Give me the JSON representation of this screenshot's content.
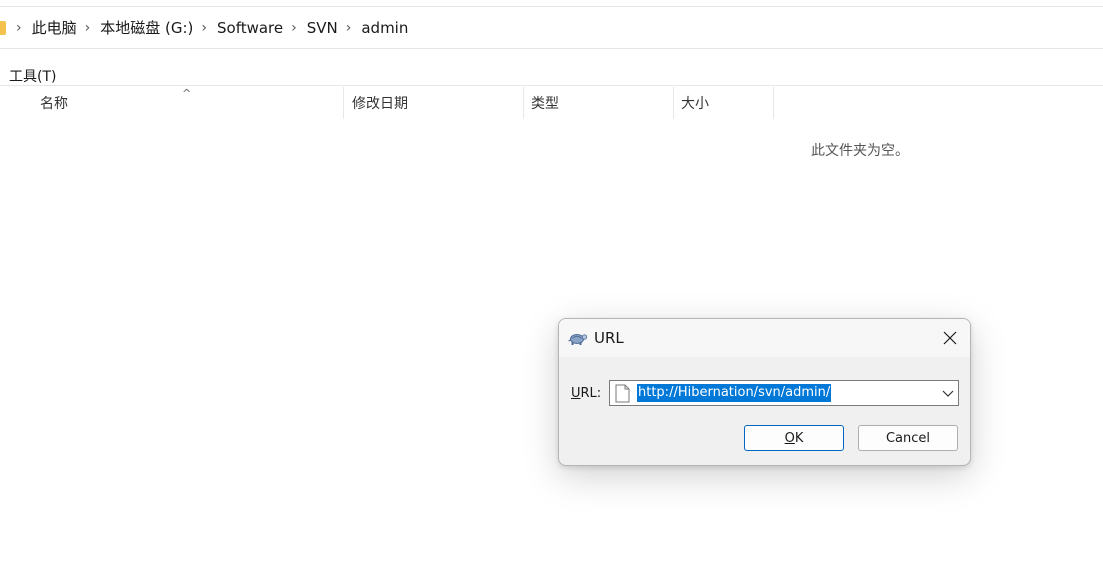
{
  "breadcrumb": {
    "items": [
      "此电脑",
      "本地磁盘 (G:)",
      "Software",
      "SVN",
      "admin"
    ]
  },
  "menu": {
    "tools": "工具(T)"
  },
  "columns": {
    "name": "名称",
    "date": "修改日期",
    "type": "类型",
    "size": "大小"
  },
  "empty_message": "此文件夹为空。",
  "dialog": {
    "title": "URL",
    "url_label_accel": "U",
    "url_label_rest": "RL:",
    "url_value": "http://Hibernation/svn/admin/",
    "ok_accel": "O",
    "ok_rest": "K",
    "cancel_label": "Cancel"
  },
  "colors": {
    "selection": "#0078d7",
    "folder": "#f2c14e",
    "ok_border": "#0067c0"
  },
  "icons": {
    "dialog_icon": "tortoise-svn-icon",
    "close": "close-icon",
    "url_doc": "document-icon",
    "dropdown": "chevron-down-icon"
  }
}
